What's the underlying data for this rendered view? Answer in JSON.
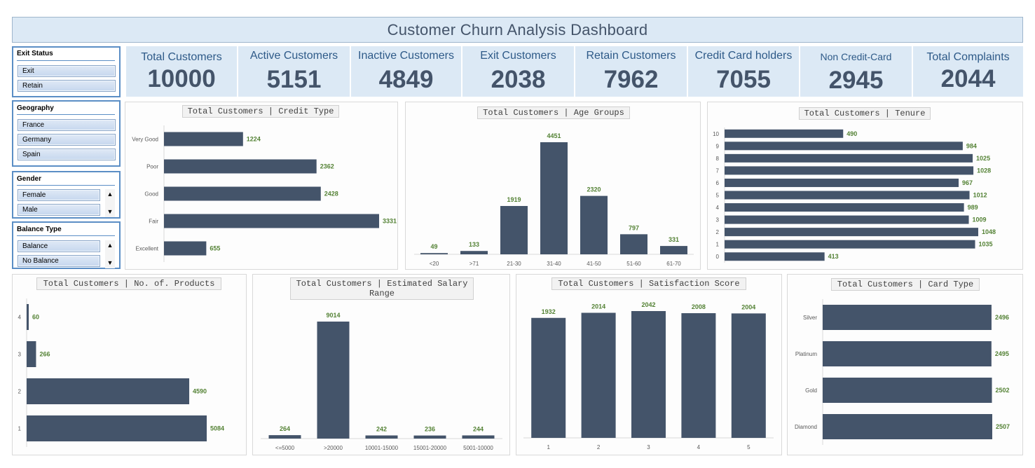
{
  "dashboard": {
    "title": "Customer Churn Analysis Dashboard"
  },
  "kpis": [
    {
      "label": "Total Customers",
      "value": "10000"
    },
    {
      "label": "Active Customers",
      "value": "5151"
    },
    {
      "label": "Inactive Customers",
      "value": "4849"
    },
    {
      "label": "Exit Customers",
      "value": "2038"
    },
    {
      "label": "Retain Customers",
      "value": "7962"
    },
    {
      "label": "Credit Card holders",
      "value": "7055"
    },
    {
      "label": "Non Credit-Card",
      "value": "2945"
    },
    {
      "label": "Total Complaints",
      "value": "2044"
    }
  ],
  "slicers": {
    "exit_status": {
      "title": "Exit Status",
      "items": [
        "Exit",
        "Retain"
      ]
    },
    "geography": {
      "title": "Geography",
      "items": [
        "France",
        "Germany",
        "Spain"
      ]
    },
    "gender": {
      "title": "Gender",
      "items": [
        "Female",
        "Male"
      ]
    },
    "balance_type": {
      "title": "Balance Type",
      "items": [
        "Balance",
        "No Balance"
      ]
    }
  },
  "colors": {
    "bar": "#44546a",
    "data_label": "#548235",
    "kpi_bg": "#dce9f5",
    "slicer_border": "#5b8ec5"
  },
  "chart_data": [
    {
      "id": "credit",
      "type": "bar",
      "orientation": "horizontal",
      "title": "Total Customers | Credit Type",
      "categories": [
        "Very Good",
        "Poor",
        "Good",
        "Fair",
        "Excellent"
      ],
      "values": [
        1224,
        2362,
        2428,
        3331,
        655
      ],
      "data_labels": true,
      "grid": false
    },
    {
      "id": "age",
      "type": "bar",
      "orientation": "vertical",
      "title": "Total Customers | Age Groups",
      "categories": [
        "<20",
        ">71",
        "21-30",
        "31-40",
        "41-50",
        "51-60",
        "61-70"
      ],
      "values": [
        49,
        133,
        1919,
        4451,
        2320,
        797,
        331
      ],
      "data_labels": true,
      "grid": false
    },
    {
      "id": "tenure",
      "type": "bar",
      "orientation": "horizontal",
      "title": "Total Customers | Tenure",
      "categories": [
        "10",
        "9",
        "8",
        "7",
        "6",
        "5",
        "4",
        "3",
        "2",
        "1",
        "0"
      ],
      "values": [
        490,
        984,
        1025,
        1028,
        967,
        1012,
        989,
        1009,
        1048,
        1035,
        413
      ],
      "data_labels": true,
      "grid": false
    },
    {
      "id": "products",
      "type": "bar",
      "orientation": "horizontal",
      "title": "Total Customers | No. of. Products",
      "categories": [
        "4",
        "3",
        "2",
        "1"
      ],
      "values": [
        60,
        266,
        4590,
        5084
      ],
      "data_labels": true,
      "grid": false
    },
    {
      "id": "salary",
      "type": "bar",
      "orientation": "vertical",
      "title": "Total Customers | Estimated Salary Range",
      "categories": [
        "<=5000",
        ">20000",
        "10001-15000",
        "15001-20000",
        "5001-10000"
      ],
      "values": [
        264,
        9014,
        242,
        236,
        244
      ],
      "data_labels": true,
      "grid": false
    },
    {
      "id": "satisfaction",
      "type": "bar",
      "orientation": "vertical",
      "title": "Total Customers | Satisfaction Score",
      "categories": [
        "1",
        "2",
        "3",
        "4",
        "5"
      ],
      "values": [
        1932,
        2014,
        2042,
        2008,
        2004
      ],
      "data_labels": true,
      "grid": false
    },
    {
      "id": "card",
      "type": "bar",
      "orientation": "horizontal",
      "title": "Total Customers | Card Type",
      "categories": [
        "Silver",
        "Platinum",
        "Gold",
        "Diamond"
      ],
      "values": [
        2496,
        2495,
        2502,
        2507
      ],
      "data_labels": true,
      "grid": false
    }
  ]
}
